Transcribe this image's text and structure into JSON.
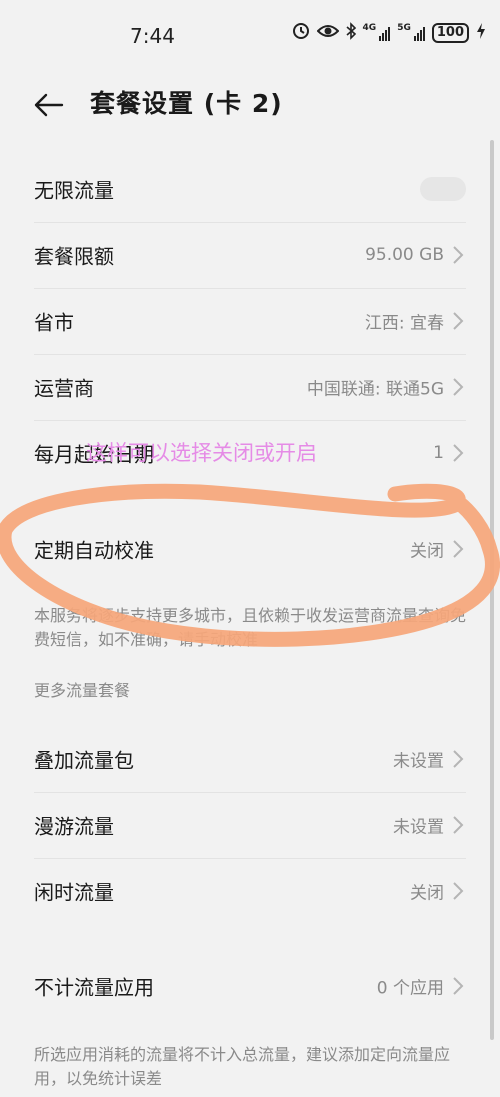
{
  "status_bar": {
    "time": "7:44",
    "battery": "100",
    "net1": "4G",
    "net2": "5G"
  },
  "header": {
    "title": "套餐设置 (卡 2)"
  },
  "settings": {
    "unlimited": {
      "label": "无限流量",
      "enabled": false
    },
    "quota": {
      "label": "套餐限额",
      "value": "95.00 GB"
    },
    "province": {
      "label": "省市",
      "value": "江西: 宜春"
    },
    "carrier": {
      "label": "运营商",
      "value": "中国联通: 联通5G"
    },
    "start_date": {
      "label": "每月起始日期",
      "value": "1"
    },
    "auto_calibrate": {
      "label": "定期自动校准",
      "value": "关闭"
    },
    "calibrate_note": "本服务将逐步支持更多城市，且依赖于收发运营商流量查询免费短信，如不准确，请手动校准"
  },
  "more_plans": {
    "title": "更多流量套餐",
    "addon": {
      "label": "叠加流量包",
      "value": "未设置"
    },
    "roaming": {
      "label": "漫游流量",
      "value": "未设置"
    },
    "idle": {
      "label": "闲时流量",
      "value": "关闭"
    }
  },
  "excluded": {
    "label": "不计流量应用",
    "value": "0 个应用",
    "note": "所选应用消耗的流量将不计入总流量，建议添加定向流量应用，以免统计误差"
  },
  "annotation": {
    "text": "这样可以选择关闭或开启",
    "text_color": "#e58be6",
    "ellipse_color": "#f6a679"
  }
}
